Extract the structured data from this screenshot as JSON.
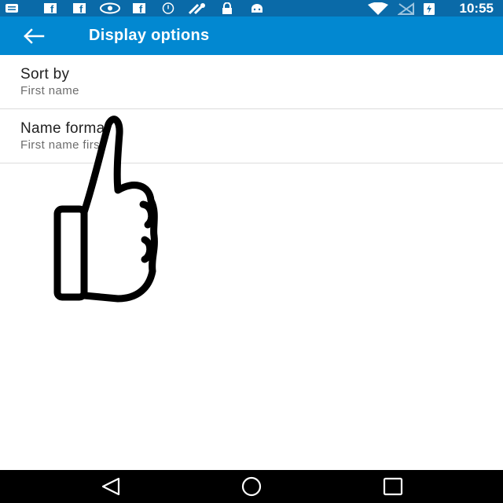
{
  "status_bar": {
    "time": "10:55",
    "left_icons": [
      "message-icon",
      "facebook-icon",
      "facebook-icon",
      "eye-icon",
      "facebook-icon",
      "alarm-icon",
      "satellite-icon",
      "lock-icon",
      "android-icon"
    ],
    "right_icons": [
      "wifi-icon",
      "no-signal-icon",
      "battery-charging-icon"
    ]
  },
  "app_bar": {
    "title": "Display options",
    "back_icon": "arrow-back-icon",
    "color": "#0288d1"
  },
  "preferences": [
    {
      "title": "Sort by",
      "summary": "First name"
    },
    {
      "title": "Name format",
      "summary": "First name first"
    }
  ],
  "nav_bar": {
    "buttons": [
      "back-triangle-icon",
      "home-circle-icon",
      "recents-square-icon"
    ]
  }
}
